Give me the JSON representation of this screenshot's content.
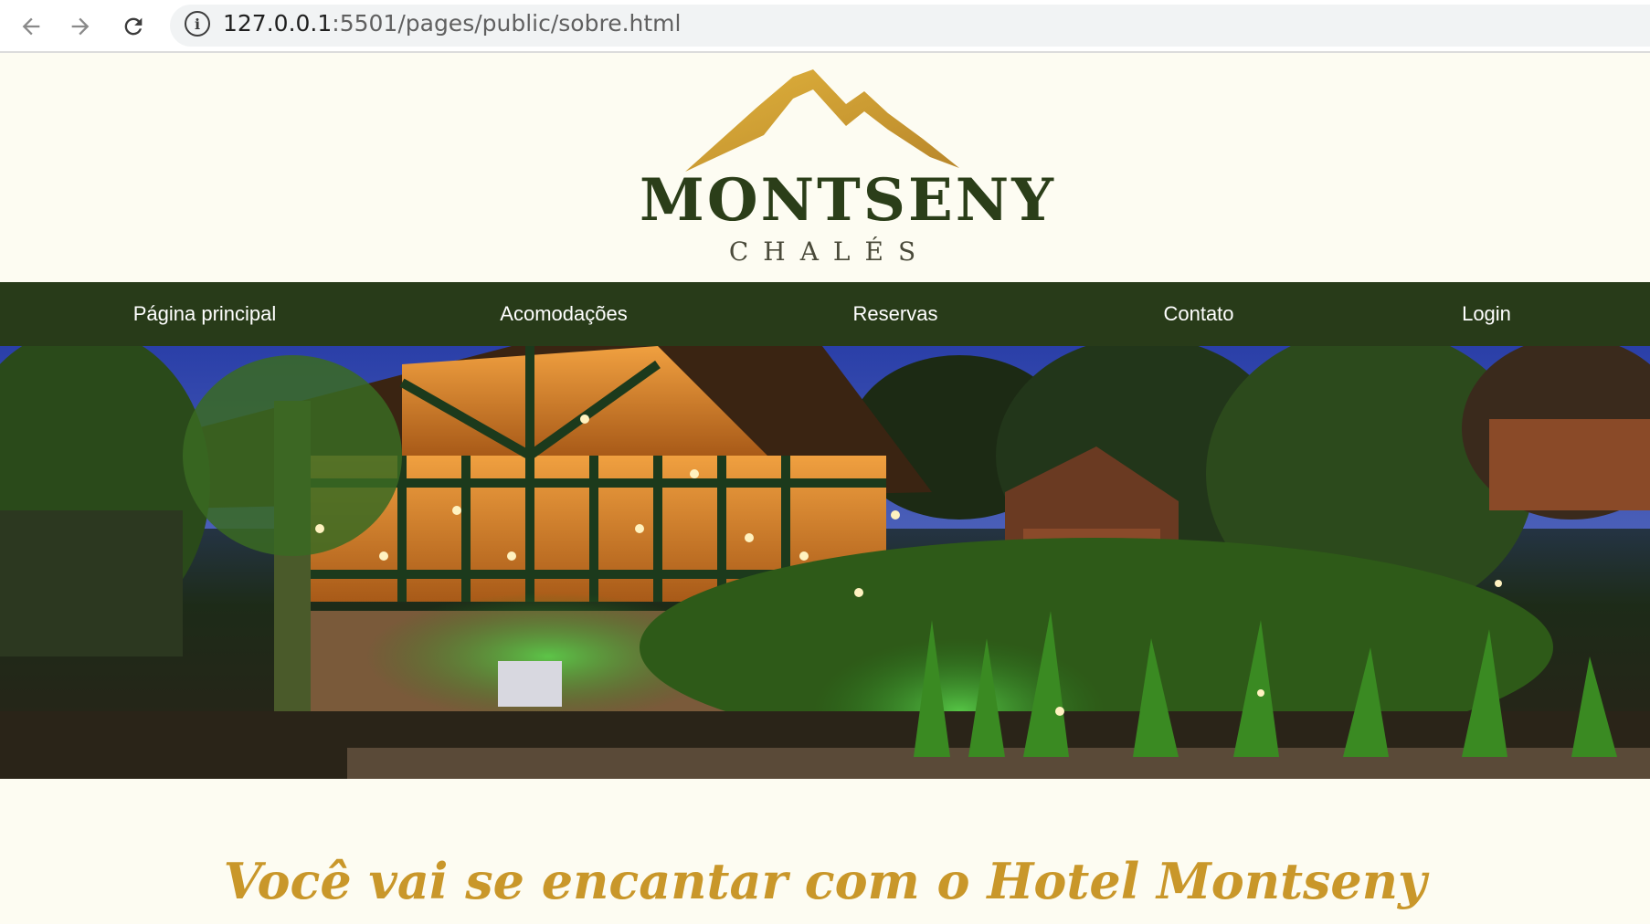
{
  "browser": {
    "url_host": "127.0.0.1",
    "url_path": ":5501/pages/public/sobre.html",
    "back_icon": "arrow-left-icon",
    "forward_icon": "arrow-right-icon",
    "reload_icon": "reload-icon",
    "info_icon": "info-icon"
  },
  "logo": {
    "name": "MONTSENY",
    "subtitle": "CHALÉS",
    "mountain_color": "#c9972a",
    "name_color": "#2b3e19"
  },
  "nav": {
    "background": "#283b19",
    "items": [
      {
        "label": "Página principal"
      },
      {
        "label": "Acomodações"
      },
      {
        "label": "Reservas"
      },
      {
        "label": "Contato"
      },
      {
        "label": "Login"
      }
    ]
  },
  "hero": {
    "description": "night photo of hotel lodge with lit windows and garden"
  },
  "main": {
    "heading": "Você vai se encantar com o Hotel Montseny",
    "heading_color": "#c9972a"
  },
  "page": {
    "background": "#fdfcf2"
  }
}
